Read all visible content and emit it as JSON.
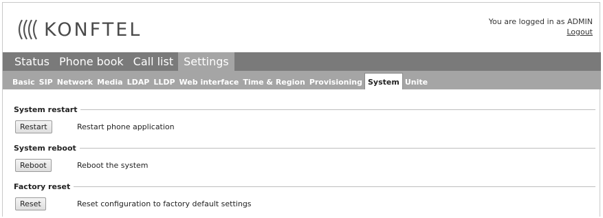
{
  "brand": {
    "name": "KONFTEL"
  },
  "login": {
    "status": "You are logged in as ADMIN",
    "logout": "Logout"
  },
  "main_tabs": [
    {
      "label": "Status"
    },
    {
      "label": "Phone book"
    },
    {
      "label": "Call list"
    },
    {
      "label": "Settings",
      "active": true
    }
  ],
  "sub_tabs": [
    {
      "label": "Basic"
    },
    {
      "label": "SIP"
    },
    {
      "label": "Network"
    },
    {
      "label": "Media"
    },
    {
      "label": "LDAP"
    },
    {
      "label": "LLDP"
    },
    {
      "label": "Web interface"
    },
    {
      "label": "Time & Region"
    },
    {
      "label": "Provisioning"
    },
    {
      "label": "System",
      "active": true
    },
    {
      "label": "Unite"
    }
  ],
  "sections": [
    {
      "title": "System restart",
      "button": "Restart",
      "description": "Restart phone application"
    },
    {
      "title": "System reboot",
      "button": "Reboot",
      "description": "Reboot the system"
    },
    {
      "title": "Factory reset",
      "button": "Reset",
      "description": "Reset configuration to factory default settings"
    }
  ],
  "colors": {
    "main_nav": "#7a7a7a",
    "active_tab": "#a5a5a5",
    "sub_nav": "#a5a5a5"
  },
  "icons": {
    "logo": "konftel-wave-logo-icon"
  }
}
